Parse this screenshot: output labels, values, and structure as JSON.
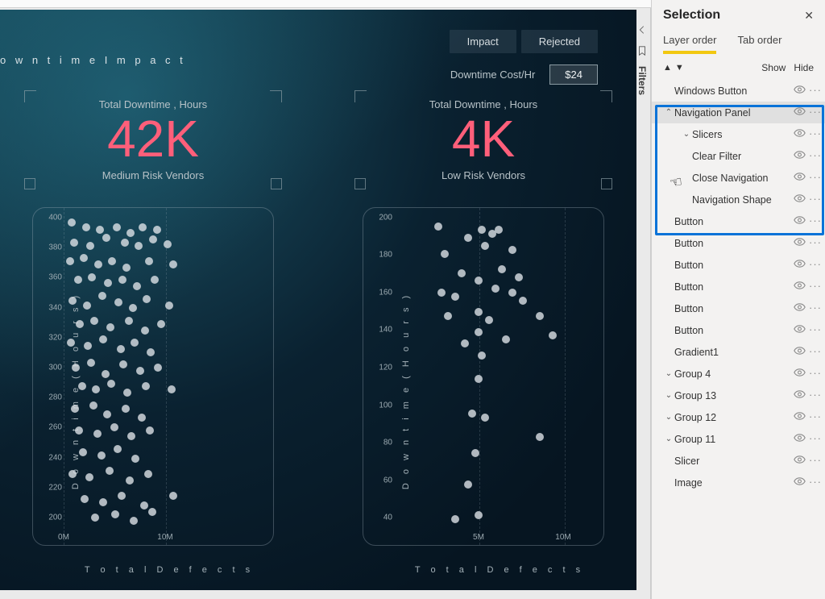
{
  "page_title": "o w n t i m e I m p a c t",
  "tabs": {
    "impact": "Impact",
    "rejected": "Rejected"
  },
  "cost": {
    "label": "Downtime Cost/Hr",
    "value": "$24"
  },
  "cards": {
    "left": {
      "label": "Total Downtime , Hours",
      "value": "42K",
      "sub": "Medium Risk Vendors"
    },
    "right": {
      "label": "Total Downtime , Hours",
      "value": "4K",
      "sub": "Low Risk Vendors"
    }
  },
  "axes": {
    "y_label": "D o w n t i m e  ( H o u r s )",
    "x_label": "T o t a l   D e f e c t s"
  },
  "chart_data": [
    {
      "type": "scatter",
      "title": "Medium Risk Vendors",
      "xlabel": "Total Defects",
      "ylabel": "Downtime (Hours)",
      "xlim": [
        0,
        20000000
      ],
      "ylim": [
        200,
        400
      ],
      "x_tick_labels": [
        "0M",
        "10M"
      ],
      "x_tick_positions": [
        0,
        10000000
      ],
      "y_ticks": [
        200,
        220,
        240,
        260,
        280,
        300,
        320,
        340,
        360,
        380,
        400
      ],
      "points": [
        [
          800000,
          395
        ],
        [
          2200000,
          392
        ],
        [
          3600000,
          390
        ],
        [
          5200000,
          392
        ],
        [
          6600000,
          388
        ],
        [
          7800000,
          392
        ],
        [
          9200000,
          390
        ],
        [
          1000000,
          382
        ],
        [
          2600000,
          380
        ],
        [
          4200000,
          385
        ],
        [
          6000000,
          382
        ],
        [
          7400000,
          380
        ],
        [
          8800000,
          384
        ],
        [
          10200000,
          381
        ],
        [
          600000,
          370
        ],
        [
          2000000,
          372
        ],
        [
          3400000,
          368
        ],
        [
          4800000,
          370
        ],
        [
          6200000,
          366
        ],
        [
          8400000,
          370
        ],
        [
          10800000,
          368
        ],
        [
          1400000,
          358
        ],
        [
          2800000,
          360
        ],
        [
          4400000,
          356
        ],
        [
          5800000,
          358
        ],
        [
          7200000,
          354
        ],
        [
          9000000,
          358
        ],
        [
          900000,
          345
        ],
        [
          2300000,
          342
        ],
        [
          3800000,
          348
        ],
        [
          5400000,
          344
        ],
        [
          6800000,
          340
        ],
        [
          8200000,
          346
        ],
        [
          10400000,
          342
        ],
        [
          1600000,
          330
        ],
        [
          3000000,
          332
        ],
        [
          4600000,
          328
        ],
        [
          6400000,
          332
        ],
        [
          8000000,
          326
        ],
        [
          9600000,
          330
        ],
        [
          700000,
          318
        ],
        [
          2400000,
          316
        ],
        [
          3900000,
          320
        ],
        [
          5600000,
          314
        ],
        [
          7000000,
          318
        ],
        [
          8600000,
          312
        ],
        [
          1200000,
          302
        ],
        [
          2700000,
          305
        ],
        [
          4100000,
          298
        ],
        [
          5900000,
          304
        ],
        [
          7500000,
          300
        ],
        [
          9300000,
          302
        ],
        [
          1800000,
          290
        ],
        [
          3200000,
          288
        ],
        [
          4700000,
          292
        ],
        [
          6300000,
          286
        ],
        [
          8100000,
          290
        ],
        [
          10600000,
          288
        ],
        [
          1100000,
          276
        ],
        [
          2900000,
          278
        ],
        [
          4300000,
          272
        ],
        [
          6100000,
          276
        ],
        [
          7700000,
          270
        ],
        [
          1500000,
          262
        ],
        [
          3300000,
          260
        ],
        [
          5000000,
          264
        ],
        [
          6700000,
          258
        ],
        [
          8500000,
          262
        ],
        [
          1900000,
          248
        ],
        [
          3700000,
          246
        ],
        [
          5300000,
          250
        ],
        [
          7100000,
          244
        ],
        [
          900000,
          234
        ],
        [
          2500000,
          232
        ],
        [
          4500000,
          236
        ],
        [
          6500000,
          230
        ],
        [
          8300000,
          234
        ],
        [
          10800000,
          220
        ],
        [
          2100000,
          218
        ],
        [
          3900000,
          216
        ],
        [
          5700000,
          220
        ],
        [
          7900000,
          214
        ],
        [
          3100000,
          206
        ],
        [
          5100000,
          208
        ],
        [
          6900000,
          204
        ],
        [
          8700000,
          210
        ]
      ]
    },
    {
      "type": "scatter",
      "title": "Low Risk Vendors",
      "xlabel": "Total Defects",
      "ylabel": "Downtime (Hours)",
      "xlim": [
        0,
        12000000
      ],
      "ylim": [
        40,
        200
      ],
      "x_tick_labels": [
        "5M",
        "10M"
      ],
      "x_tick_positions": [
        5000000,
        10000000
      ],
      "y_ticks": [
        40,
        60,
        80,
        100,
        120,
        140,
        160,
        180,
        200
      ],
      "points": [
        [
          2600000,
          194
        ],
        [
          5200000,
          192
        ],
        [
          4400000,
          188
        ],
        [
          5800000,
          190
        ],
        [
          6200000,
          192
        ],
        [
          5400000,
          184
        ],
        [
          3000000,
          180
        ],
        [
          7000000,
          182
        ],
        [
          4000000,
          170
        ],
        [
          6400000,
          172
        ],
        [
          7400000,
          168
        ],
        [
          5000000,
          166
        ],
        [
          2800000,
          160
        ],
        [
          3600000,
          158
        ],
        [
          6000000,
          162
        ],
        [
          7000000,
          160
        ],
        [
          7600000,
          156
        ],
        [
          3200000,
          148
        ],
        [
          5000000,
          150
        ],
        [
          5600000,
          146
        ],
        [
          8600000,
          148
        ],
        [
          5000000,
          140
        ],
        [
          4200000,
          134
        ],
        [
          6600000,
          136
        ],
        [
          9400000,
          138
        ],
        [
          5200000,
          128
        ],
        [
          5000000,
          116
        ],
        [
          4600000,
          98
        ],
        [
          5400000,
          96
        ],
        [
          4800000,
          78
        ],
        [
          8600000,
          86
        ],
        [
          4400000,
          62
        ],
        [
          3600000,
          44
        ],
        [
          5000000,
          46
        ]
      ]
    }
  ],
  "filters_label": "Filters",
  "selection": {
    "title": "Selection",
    "tabs": {
      "layer": "Layer order",
      "tab": "Tab order"
    },
    "show": "Show",
    "hide": "Hide",
    "tree": [
      {
        "label": "Windows Button",
        "indent": 0,
        "chev": ""
      },
      {
        "label": "Navigation Panel",
        "indent": 0,
        "chev": "up",
        "selected": true
      },
      {
        "label": "Slicers",
        "indent": 1,
        "chev": "down"
      },
      {
        "label": "Clear Filter",
        "indent": 1,
        "chev": ""
      },
      {
        "label": "Close Navigation",
        "indent": 1,
        "chev": ""
      },
      {
        "label": "Navigation Shape",
        "indent": 1,
        "chev": ""
      },
      {
        "label": "Button",
        "indent": 0,
        "chev": ""
      },
      {
        "label": "Button",
        "indent": 0,
        "chev": ""
      },
      {
        "label": "Button",
        "indent": 0,
        "chev": ""
      },
      {
        "label": "Button",
        "indent": 0,
        "chev": ""
      },
      {
        "label": "Button",
        "indent": 0,
        "chev": ""
      },
      {
        "label": "Button",
        "indent": 0,
        "chev": ""
      },
      {
        "label": "Gradient1",
        "indent": 0,
        "chev": ""
      },
      {
        "label": "Group 4",
        "indent": 0,
        "chev": "down"
      },
      {
        "label": "Group 13",
        "indent": 0,
        "chev": "down"
      },
      {
        "label": "Group 12",
        "indent": 0,
        "chev": "down"
      },
      {
        "label": "Group 11",
        "indent": 0,
        "chev": "down"
      },
      {
        "label": "Slicer",
        "indent": 0,
        "chev": ""
      },
      {
        "label": "Image",
        "indent": 0,
        "chev": ""
      }
    ]
  }
}
